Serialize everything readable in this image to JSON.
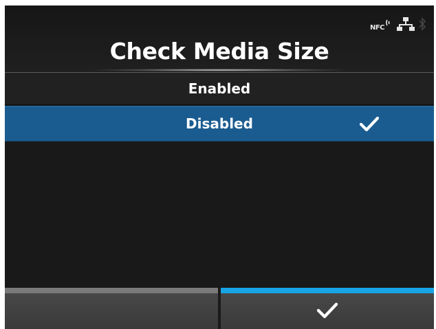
{
  "header": {
    "title": "Check Media Size",
    "status_icons": {
      "nfc_label": "NFC",
      "icons": [
        "nfc-icon",
        "network-icon",
        "bluetooth-icon"
      ]
    }
  },
  "list": {
    "items": [
      {
        "label": "Enabled",
        "selected": false
      },
      {
        "label": "Disabled",
        "selected": true,
        "icon": "checkmark-icon"
      }
    ]
  },
  "softkeys": {
    "left": {
      "label": "",
      "bar_color": "#7a7a7a"
    },
    "right": {
      "icon": "checkmark-icon",
      "bar_color": "#18a5e6"
    }
  },
  "colors": {
    "background": "#191919",
    "selected_row": "#1b5c90",
    "accent": "#18a5e6",
    "text": "#ffffff"
  }
}
